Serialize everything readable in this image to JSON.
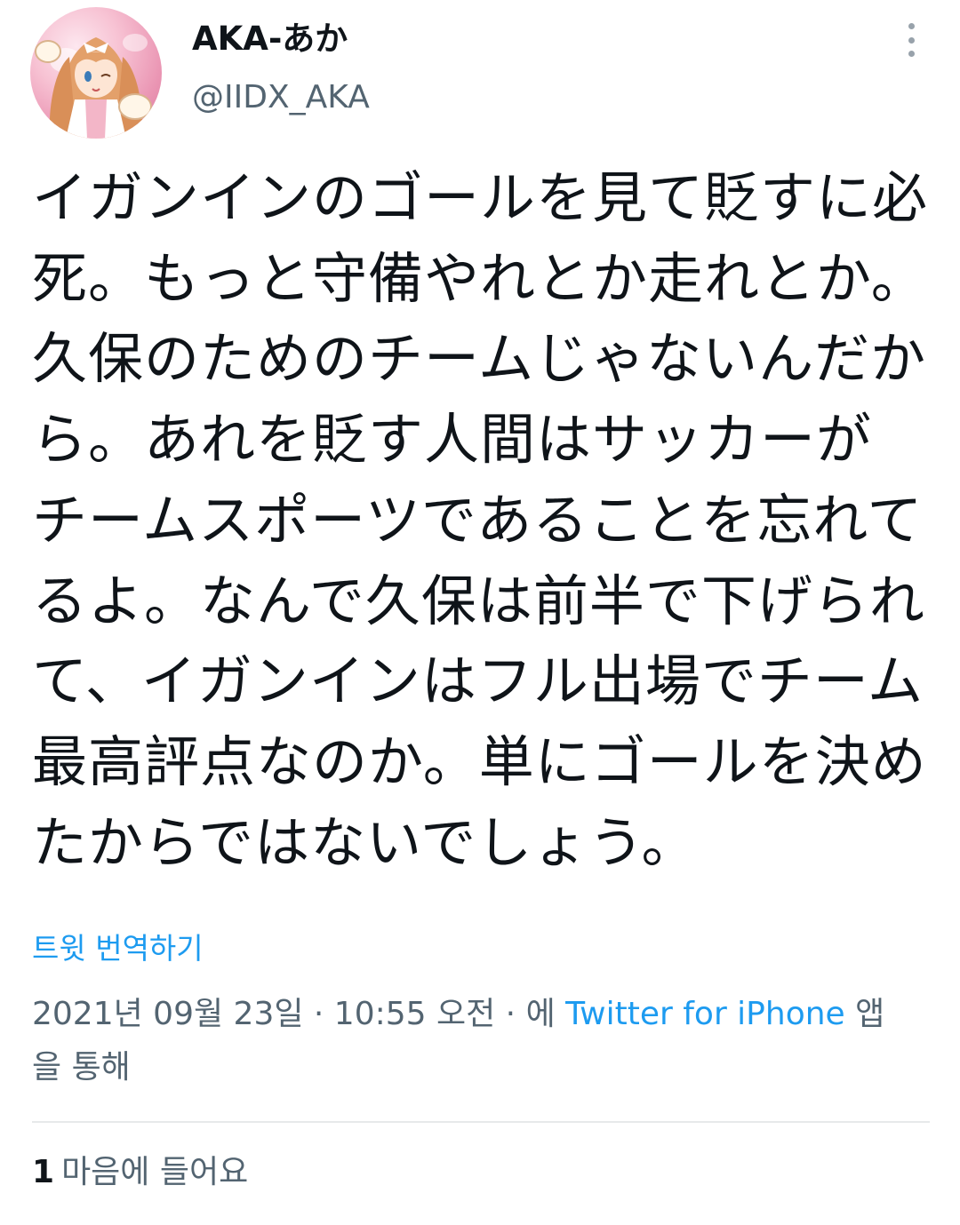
{
  "user": {
    "display_name": "AKA-あか",
    "handle": "@IIDX_AKA",
    "avatar_icon": "anime-character-avatar"
  },
  "tweet": {
    "text_lines": [
      "イガンインのゴールを見て貶すに必",
      "死。もっと守備やれとか走れとか。",
      "久保のためのチームじゃないんだか",
      "ら。あれを貶す人間はサッカーが",
      "チームスポーツであることを忘れて",
      "るよ。なんで久保は前半で下げられ",
      "て、イガンインはフル出場でチーム",
      "最高評点なのか。単にゴールを決め",
      "たからではないでしょう。"
    ]
  },
  "translate_label": "트윗 번역하기",
  "meta": {
    "datetime": "2021년 09월 23일 · 10:55 오전 · 에 ",
    "source": "Twitter for iPhone",
    "suffix_line1": " 앱",
    "suffix_line2": "을 통해"
  },
  "stats": {
    "likes_count": "1",
    "likes_label": "마음에 들어요"
  },
  "icons": {
    "more": "more-vertical-icon"
  },
  "colors": {
    "text": "#0f1419",
    "secondary": "#536471",
    "link": "#1d9bf0",
    "divider": "#e7e9ea"
  }
}
